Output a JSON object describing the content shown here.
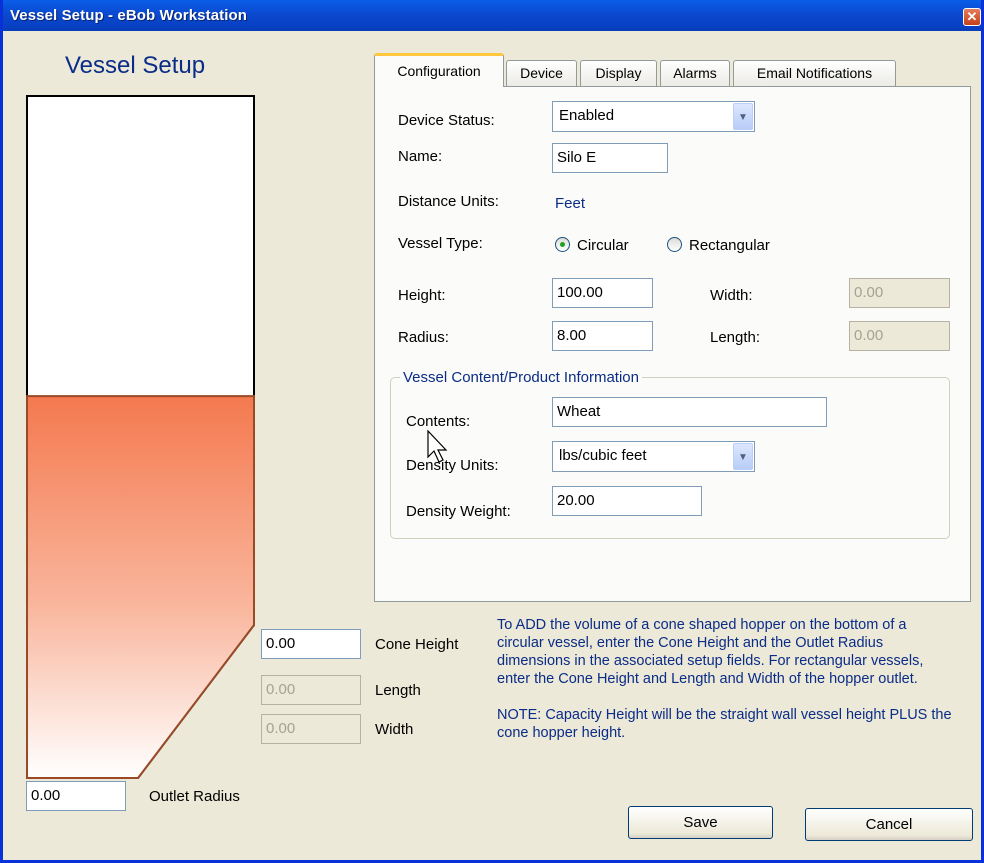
{
  "window": {
    "title": "Vessel Setup - eBob Workstation",
    "close_glyph": "✕"
  },
  "heading": "Vessel Setup",
  "vessel": {
    "fill_level": 0.56,
    "fill_color": "#f4794f",
    "outline_color": "#9a4a26"
  },
  "tabs": [
    {
      "label": "Configuration",
      "active": true
    },
    {
      "label": "Device",
      "active": false
    },
    {
      "label": "Display",
      "active": false
    },
    {
      "label": "Alarms",
      "active": false
    },
    {
      "label": "Email Notifications",
      "active": false
    }
  ],
  "config": {
    "device_status_label": "Device Status:",
    "device_status_value": "Enabled",
    "name_label": "Name:",
    "name_value": "Silo E",
    "distance_units_label": "Distance Units:",
    "distance_units_value": "Feet",
    "vessel_type_label": "Vessel Type:",
    "vessel_type_options": [
      "Circular",
      "Rectangular"
    ],
    "vessel_type_selected": "Circular",
    "height_label": "Height:",
    "height_value": "100.00",
    "radius_label": "Radius:",
    "radius_value": "8.00",
    "width_label": "Width:",
    "width_value": "0.00",
    "length_label": "Length:",
    "length_value": "0.00"
  },
  "content_group": {
    "title": "Vessel Content/Product Information",
    "contents_label": "Contents:",
    "contents_value": "Wheat",
    "density_units_label": "Density Units:",
    "density_units_value": "lbs/cubic feet",
    "density_weight_label": "Density Weight:",
    "density_weight_value": "20.00"
  },
  "cone": {
    "cone_height_label": "Cone Height",
    "cone_height_value": "0.00",
    "length_label": "Length",
    "length_value": "0.00",
    "width_label": "Width",
    "width_value": "0.00",
    "outlet_radius_label": "Outlet Radius",
    "outlet_radius_value": "0.00"
  },
  "info": {
    "paragraph1": "To ADD the volume of a cone shaped hopper on the bottom of a circular vessel, enter the Cone Height and the Outlet Radius dimensions in the associated setup fields. For rectangular vessels, enter the Cone Height and Length and Width of the hopper outlet.",
    "paragraph2": "NOTE:  Capacity Height will be the straight wall vessel height PLUS the cone hopper height."
  },
  "buttons": {
    "save": "Save",
    "cancel": "Cancel"
  },
  "colors": {
    "title_bar": "#0a5ee8",
    "label_blue": "#0b2c87",
    "dialog_bg": "#ece9d8",
    "panel_bg": "#fbfbf9"
  }
}
